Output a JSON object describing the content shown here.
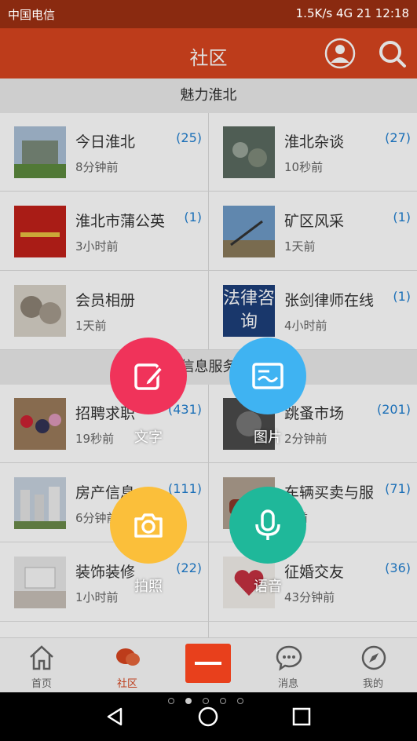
{
  "status": {
    "carrier": "中国电信",
    "right": "1.5K/s  4G 21  12:18"
  },
  "header": {
    "title": "社区"
  },
  "sections": [
    {
      "title": "魅力淮北",
      "items": [
        {
          "name": "今日淮北",
          "time": "8分钟前",
          "count": "(25)"
        },
        {
          "name": "淮北杂谈",
          "time": "10秒前",
          "count": "(27)"
        },
        {
          "name": "淮北市蒲公英",
          "time": "3小时前",
          "count": "(1)"
        },
        {
          "name": "矿区风采",
          "time": "1天前",
          "count": "(1)"
        },
        {
          "name": "会员相册",
          "time": "1天前",
          "count": ""
        },
        {
          "name": "张剑律师在线",
          "time": "4小时前",
          "count": "(1)"
        }
      ]
    },
    {
      "title": "信息服务",
      "items": [
        {
          "name": "招聘求职",
          "time": "19秒前",
          "count": "(431)"
        },
        {
          "name": "跳蚤市场",
          "time": "2分钟前",
          "count": "(201)"
        },
        {
          "name": "房产信息",
          "time": "6分钟前",
          "count": "(111)"
        },
        {
          "name": "车辆买卖与服",
          "time": "钟前",
          "count": "(71)"
        },
        {
          "name": "装饰装修",
          "time": "1小时前",
          "count": "(22)"
        },
        {
          "name": "征婚交友",
          "time": "43分钟前",
          "count": "(36)"
        }
      ]
    }
  ],
  "thumb_text": {
    "lawyer": "法律咨询"
  },
  "fab": {
    "text": "文字",
    "image": "图片",
    "photo": "拍照",
    "voice": "语音"
  },
  "nav": {
    "home": "首页",
    "community": "社区",
    "messages": "消息",
    "mine": "我的"
  },
  "colors": {
    "accent": "#d8451f",
    "link": "#1f7fd1",
    "fab_text": "#f0335a",
    "fab_image": "#3fb3f2",
    "fab_photo": "#fbbf3a",
    "fab_voice": "#1fb89a"
  }
}
